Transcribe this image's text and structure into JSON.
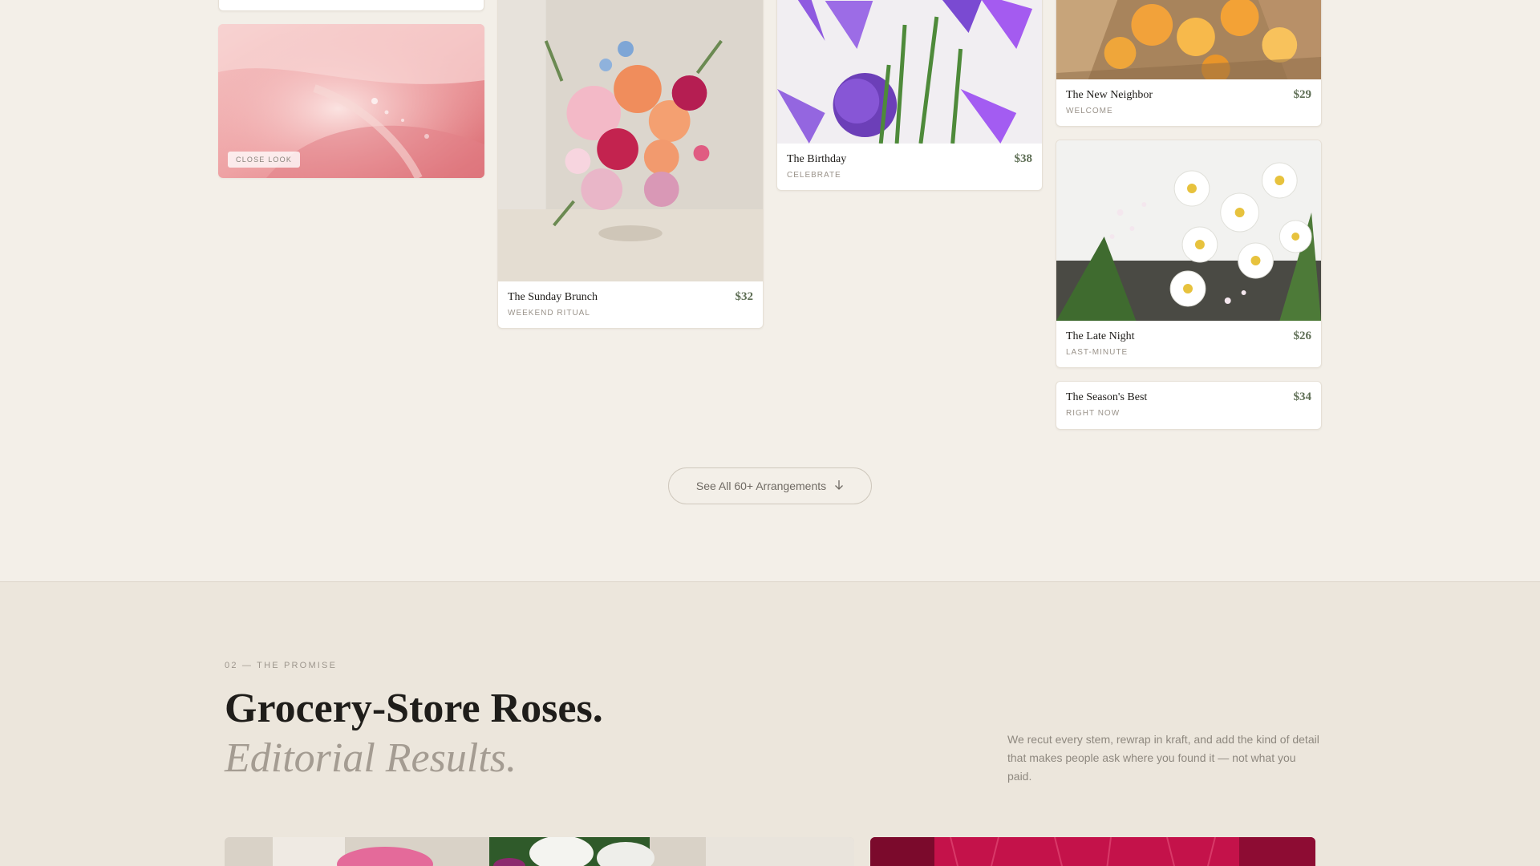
{
  "gallery": {
    "top_card_stub": {},
    "close_look": {
      "badge": "CLOSE LOOK"
    },
    "cards": [
      {
        "title": "The Sunday Brunch",
        "tag": "WEEKEND RITUAL",
        "price": "$32"
      },
      {
        "title": "The Birthday",
        "tag": "CELEBRATE",
        "price": "$38"
      },
      {
        "title": "The New Neighbor",
        "tag": "WELCOME",
        "price": "$29"
      },
      {
        "title": "The Late Night",
        "tag": "LAST-MINUTE",
        "price": "$26"
      },
      {
        "title": "The Season's Best",
        "tag": "RIGHT NOW",
        "price": "$34"
      }
    ],
    "see_all": {
      "label": "See All 60+ Arrangements",
      "icon": "arrow-down-icon"
    }
  },
  "promise": {
    "eyebrow": "02 — THE PROMISE",
    "headline": "Grocery-Store Roses.",
    "headline_italic": "Editorial Results.",
    "copy": "We recut every stem, rewrap in kraft, and add the kind of detail that makes people ask where you found it — not what you paid."
  },
  "colors": {
    "background": "#f3efe8",
    "section_background": "#ece6dc",
    "price_green": "#5e6e55",
    "muted_text": "#9a938a"
  }
}
